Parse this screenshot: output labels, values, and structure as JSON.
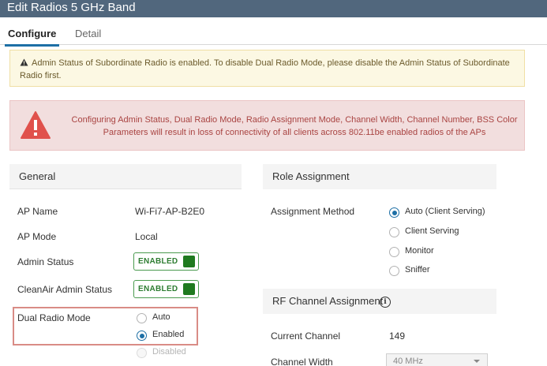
{
  "window": {
    "title": "Edit Radios 5 GHz Band"
  },
  "tabs": [
    {
      "label": "Configure",
      "active": true
    },
    {
      "label": "Detail",
      "active": false
    }
  ],
  "warning": {
    "icon": "warning-triangle-icon",
    "text": "Admin Status of Subordinate Radio is enabled. To disable Dual Radio Mode, please disable the Admin Status of Subordinate Radio first."
  },
  "alert": {
    "icon": "alert-triangle-icon",
    "text": "Configuring Admin Status, Dual Radio Mode, Radio Assignment Mode, Channel Width, Channel Number, BSS Color Parameters will result in loss of connectivity of all clients across 802.11be enabled radios of the APs"
  },
  "general": {
    "title": "General",
    "ap_name_label": "AP Name",
    "ap_name_value": "Wi-Fi7-AP-B2E0",
    "ap_mode_label": "AP Mode",
    "ap_mode_value": "Local",
    "admin_status_label": "Admin Status",
    "admin_status_value": "ENABLED",
    "cleanair_label": "CleanAir Admin Status",
    "cleanair_value": "ENABLED",
    "dual_radio_label": "Dual Radio Mode",
    "dual_radio_options": [
      {
        "label": "Auto",
        "checked": false,
        "disabled": false
      },
      {
        "label": "Enabled",
        "checked": true,
        "disabled": false
      },
      {
        "label": "Disabled",
        "checked": false,
        "disabled": true
      }
    ]
  },
  "role": {
    "title": "Role Assignment",
    "method_label": "Assignment Method",
    "options": [
      {
        "label": "Auto (Client Serving)",
        "checked": true
      },
      {
        "label": "Client Serving",
        "checked": false
      },
      {
        "label": "Monitor",
        "checked": false
      },
      {
        "label": "Sniffer",
        "checked": false
      }
    ]
  },
  "rf": {
    "title": "RF Channel Assignment",
    "info_icon": "info-icon",
    "info_glyph": "i",
    "current_channel_label": "Current Channel",
    "current_channel_value": "149",
    "channel_width_label": "Channel Width",
    "channel_width_value": "40 MHz"
  },
  "colors": {
    "title_bar": "#51677d",
    "tab_accent": "#1d6fa5",
    "toggle_green": "#1f7a1f",
    "warning_bg": "#fcf8e3",
    "alert_bg": "#f2dede",
    "alert_text": "#a94442",
    "highlight_box": "#d98c86"
  }
}
